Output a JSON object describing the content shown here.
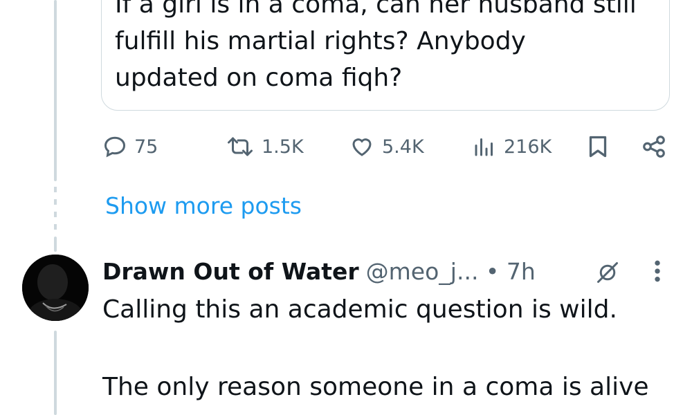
{
  "quoted_post": {
    "text": "If a girl is in a coma, can her husband still\nfulfill his martial rights? Anybody\nupdated on coma fiqh?"
  },
  "actions": {
    "reply": {
      "icon": "reply-icon",
      "count": "75"
    },
    "repost": {
      "icon": "repost-icon",
      "count": "1.5K"
    },
    "like": {
      "icon": "heart-icon",
      "count": "5.4K"
    },
    "views": {
      "icon": "views-icon",
      "count": "216K"
    },
    "bookmark": {
      "icon": "bookmark-icon"
    },
    "share": {
      "icon": "share-icon"
    }
  },
  "show_more": {
    "label": "Show more posts"
  },
  "reply": {
    "name": "Drawn Out of Water",
    "handle_time": "@meo_j... • 7h",
    "paragraphs": [
      "Calling this an academic question is wild.",
      "The only reason someone in a coma is alive"
    ]
  },
  "colors": {
    "text": "#0f1419",
    "muted": "#536471",
    "accent": "#1d9bf0",
    "border": "#cfd9de"
  }
}
